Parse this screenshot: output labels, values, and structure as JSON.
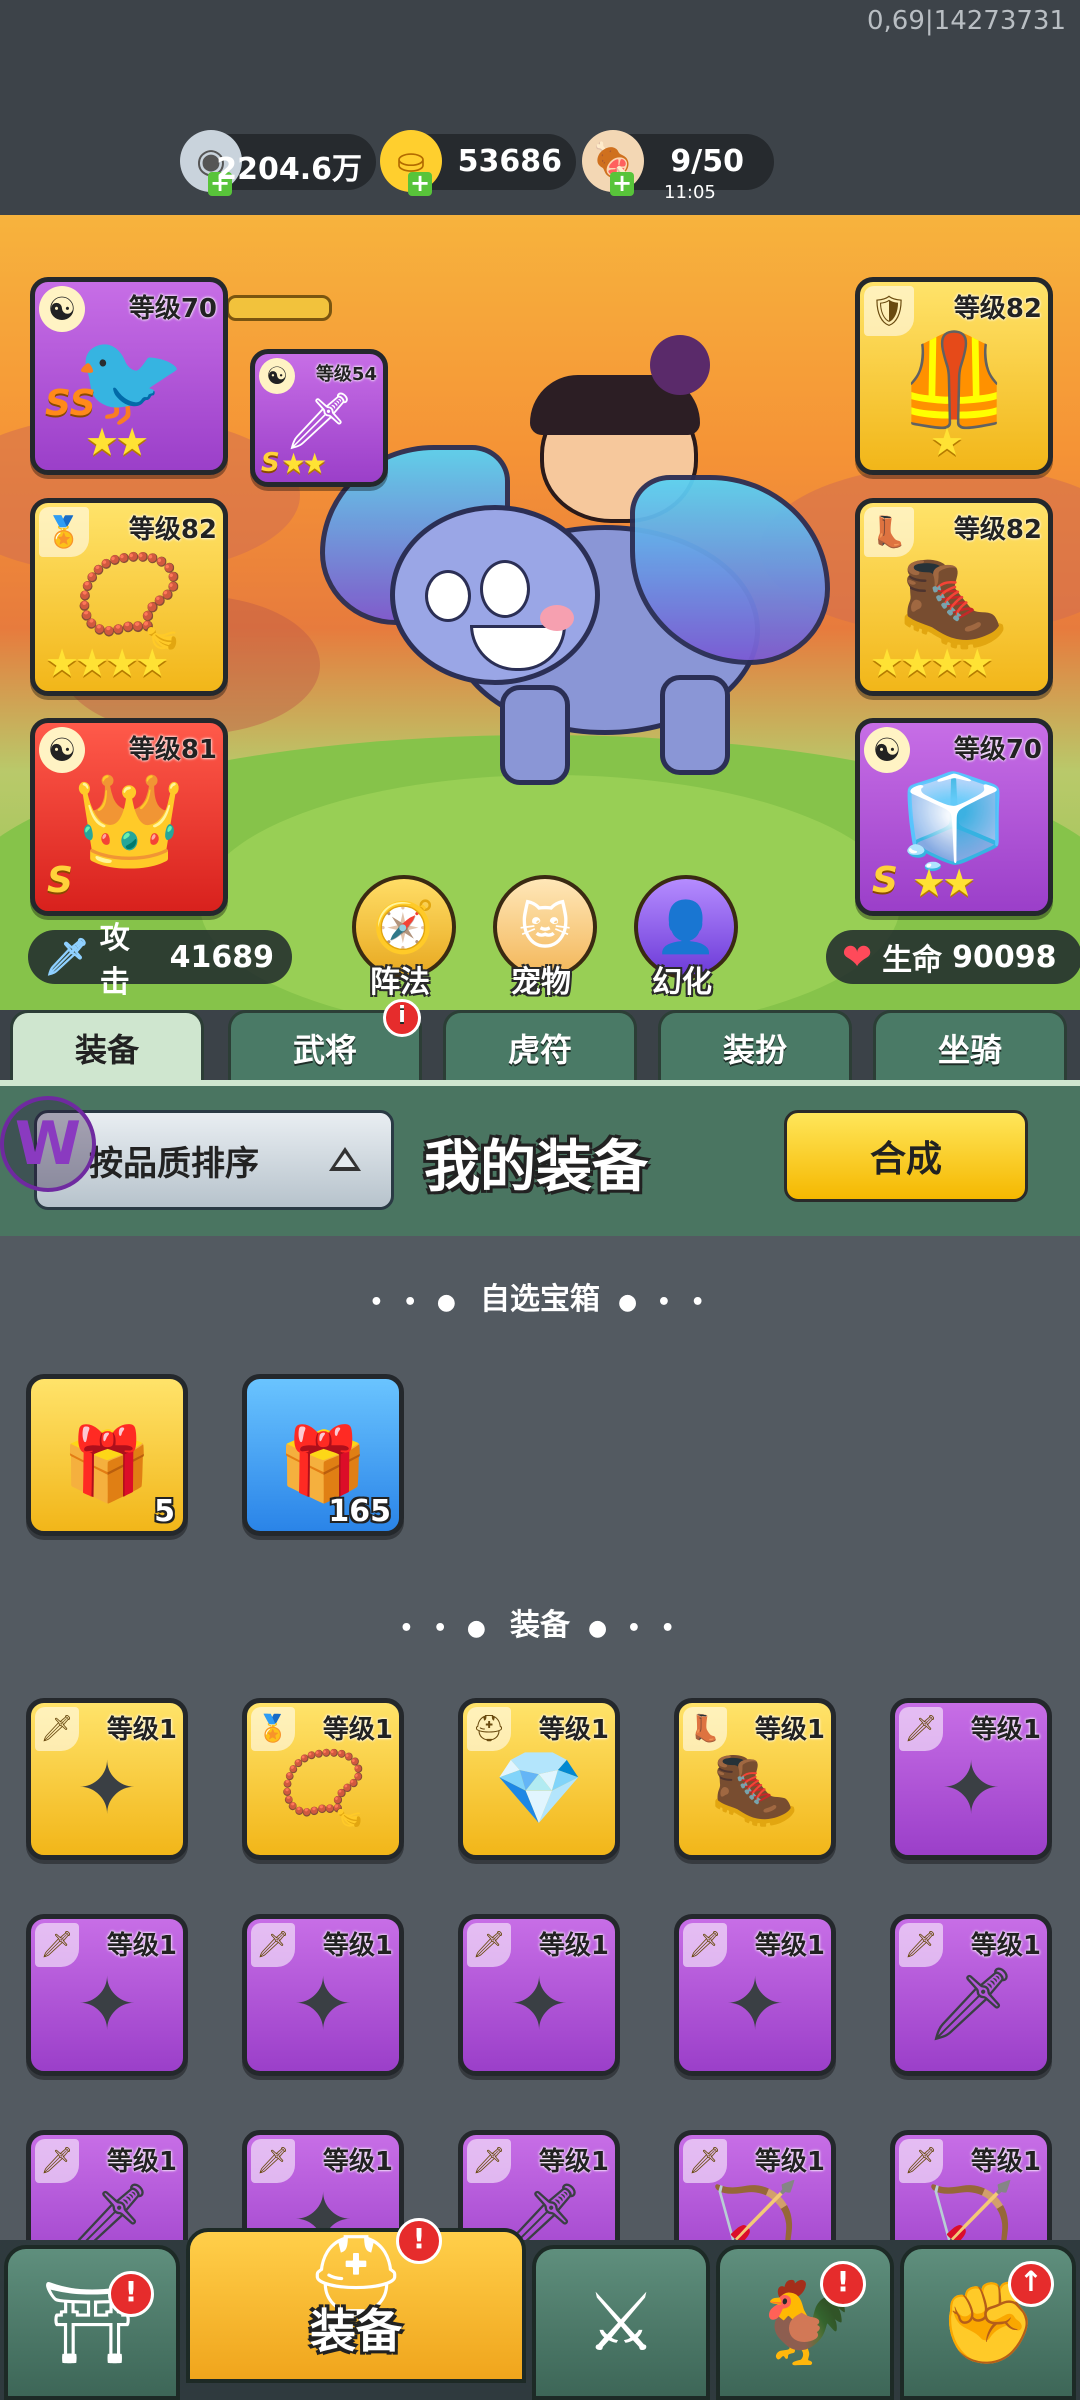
{
  "debug_text": "0,69|14273731",
  "resources": {
    "silver": {
      "value": "2204.6万",
      "icon": "silver-coin-icon"
    },
    "gold": {
      "value": "53686",
      "icon": "gold-ingot-icon"
    },
    "stamina": {
      "value": "9/50",
      "timer": "11:05",
      "icon": "meat-icon"
    }
  },
  "hero": {
    "left_slots": [
      {
        "level": "等级70",
        "color": "purple",
        "badge": "yinyang",
        "rank": "SS",
        "stars": 2,
        "icon": "phoenix-icon"
      },
      {
        "level": "等级82",
        "color": "gold",
        "badge": "medal",
        "stars": 4,
        "icon": "amulet-icon"
      },
      {
        "level": "等级81",
        "color": "red",
        "badge": "yinyang",
        "rank": "S",
        "stars": 0,
        "icon": "crown-helm-icon"
      }
    ],
    "sub_slot": {
      "level": "等级54",
      "color": "purple",
      "badge": "yinyang",
      "rank": "S",
      "stars": 2,
      "icon": "spirit-icon"
    },
    "right_slots": [
      {
        "level": "等级82",
        "color": "gold",
        "badge": "armor",
        "stars": 1,
        "icon": "chest-armor-icon"
      },
      {
        "level": "等级82",
        "color": "gold",
        "badge": "boot",
        "stars": 4,
        "icon": "boots-icon"
      },
      {
        "level": "等级70",
        "color": "purple",
        "badge": "yinyang",
        "rank": "S",
        "stars": 2,
        "icon": "ice-armor-icon"
      }
    ],
    "attack": {
      "label": "攻击",
      "value": "41689"
    },
    "hp": {
      "label": "生命",
      "value": "90098"
    },
    "buttons": {
      "formation": "阵法",
      "pet": "宠物",
      "transform": "幻化"
    }
  },
  "tabs": [
    {
      "label": "装备",
      "active": true
    },
    {
      "label": "武将",
      "active": false,
      "alert": "i"
    },
    {
      "label": "虎符",
      "active": false
    },
    {
      "label": "装扮",
      "active": false
    },
    {
      "label": "坐骑",
      "active": false
    }
  ],
  "section": {
    "sort_label": "按品质排序",
    "title": "我的装备",
    "craft_label": "合成"
  },
  "chest_divider": "自选宝箱",
  "chests": [
    {
      "color": "gold",
      "count": "5"
    },
    {
      "color": "blue",
      "count": "165"
    }
  ],
  "equip_divider": "装备",
  "equipment": [
    {
      "level": "等级1",
      "color": "gold",
      "badge": "sword",
      "icon": "shuriken-icon"
    },
    {
      "level": "等级1",
      "color": "gold",
      "badge": "medal",
      "icon": "amulet-icon"
    },
    {
      "level": "等级1",
      "color": "gold",
      "badge": "helm",
      "icon": "crystal-helm-icon"
    },
    {
      "level": "等级1",
      "color": "gold",
      "badge": "boot",
      "icon": "boots-icon"
    },
    {
      "level": "等级1",
      "color": "purple",
      "badge": "sword",
      "icon": "shuriken-icon"
    },
    {
      "level": "等级1",
      "color": "purple",
      "badge": "sword",
      "icon": "shuriken-icon"
    },
    {
      "level": "等级1",
      "color": "purple",
      "badge": "sword",
      "icon": "shuriken-icon"
    },
    {
      "level": "等级1",
      "color": "purple",
      "badge": "sword",
      "icon": "shuriken-icon"
    },
    {
      "level": "等级1",
      "color": "purple",
      "badge": "sword",
      "icon": "shuriken-icon"
    },
    {
      "level": "等级1",
      "color": "purple",
      "badge": "sword",
      "icon": "scimitar-icon"
    },
    {
      "level": "等级1",
      "color": "purple",
      "badge": "sword",
      "icon": "scimitar-icon"
    },
    {
      "level": "等级1",
      "color": "purple",
      "badge": "sword",
      "icon": "shuriken-icon"
    },
    {
      "level": "等级1",
      "color": "purple",
      "badge": "sword",
      "icon": "scimitar-icon"
    },
    {
      "level": "等级1",
      "color": "purple",
      "badge": "sword",
      "icon": "bow-icon"
    },
    {
      "level": "等级1",
      "color": "purple",
      "badge": "sword",
      "icon": "bow-icon"
    }
  ],
  "bottom_nav": [
    {
      "icon": "gate-shop-icon",
      "alert": "!"
    },
    {
      "icon": "helmet-icon",
      "label": "装备",
      "active": true,
      "alert": "!"
    },
    {
      "icon": "battle-swords-icon"
    },
    {
      "icon": "general-stars-icon",
      "alert": "!"
    },
    {
      "icon": "fist-upgrade-icon",
      "alert": "↑"
    }
  ]
}
